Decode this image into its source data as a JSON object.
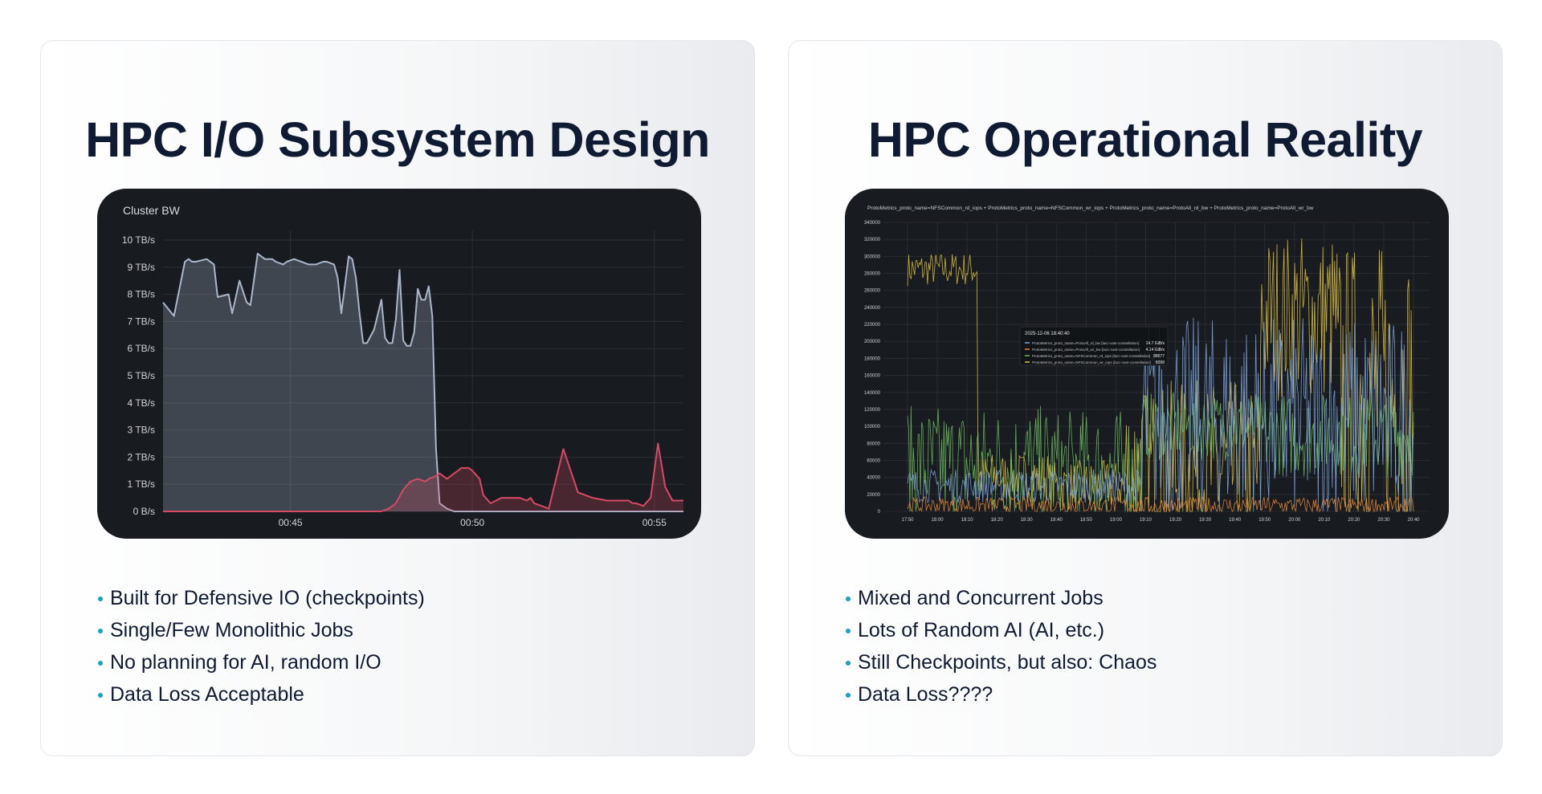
{
  "colors": {
    "title": "#0f1a33",
    "bullet": "#1a9fc4",
    "panel_bg": "#181b1f",
    "grid": "#2c3036",
    "axis_text": "#d0d3d8",
    "series_blue": "#a9b6cc",
    "series_red": "#d64a65",
    "series_lightblue": "#7ea6e0",
    "series_orange": "#e8883a",
    "series_green": "#6ebb5f",
    "series_yellow": "#e0c23f"
  },
  "left": {
    "title": "HPC I/O Subsystem Design",
    "bullets": [
      "Built for Defensive IO (checkpoints)",
      "Single/Few Monolithic Jobs",
      "No planning for AI, random I/O",
      "Data Loss Acceptable"
    ]
  },
  "right": {
    "title": "HPC Operational Reality",
    "bullets": [
      "Mixed and Concurrent Jobs",
      "Lots of Random AI (AI, etc.)",
      "Still Checkpoints, but also: Chaos",
      "Data Loss????"
    ]
  },
  "chart_data": [
    {
      "type": "area",
      "title": "Cluster BW",
      "xlabel": "",
      "ylabel": "",
      "x_ticks": [
        "00:45",
        "00:50",
        "00:55"
      ],
      "x_tick_positions": [
        3.5,
        8.5,
        13.5
      ],
      "xlim": [
        0,
        14.3
      ],
      "ylim": [
        0,
        10
      ],
      "y_ticks": [
        "0 B/s",
        "1 TB/s",
        "2 TB/s",
        "3 TB/s",
        "4 TB/s",
        "5 TB/s",
        "6 TB/s",
        "7 TB/s",
        "8 TB/s",
        "9 TB/s",
        "10 TB/s"
      ],
      "grid": true,
      "series": [
        {
          "color": "#a9b6cc",
          "x": [
            0,
            0.3,
            0.6,
            0.7,
            0.8,
            0.9,
            1.2,
            1.4,
            1.5,
            1.8,
            1.9,
            2.1,
            2.3,
            2.4,
            2.6,
            2.7,
            2.8,
            3.0,
            3.1,
            3.3,
            3.4,
            3.6,
            3.8,
            4.0,
            4.2,
            4.4,
            4.5,
            4.7,
            4.8,
            4.9,
            5.1,
            5.2,
            5.3,
            5.4,
            5.5,
            5.6,
            5.8,
            6.0,
            6.1,
            6.2,
            6.3,
            6.4,
            6.5,
            6.6,
            6.7,
            6.8,
            6.9,
            7.0,
            7.1,
            7.2,
            7.3,
            7.4,
            7.5,
            7.6,
            7.7,
            7.8,
            8.0,
            8.1,
            8.2,
            8.3,
            8.4,
            8.5,
            8.6,
            8.7,
            8.8,
            8.9,
            9.0,
            9.1,
            9.3,
            9.5,
            9.6,
            10.5,
            11.5,
            12.5,
            13.5,
            14.3
          ],
          "values": [
            7.7,
            7.2,
            9.2,
            9.3,
            9.2,
            9.2,
            9.3,
            9.1,
            7.9,
            8.0,
            7.3,
            8.5,
            7.7,
            7.6,
            9.5,
            9.4,
            9.3,
            9.3,
            9.2,
            9.1,
            9.2,
            9.3,
            9.2,
            9.1,
            9.1,
            9.2,
            9.2,
            9.1,
            8.6,
            7.3,
            9.4,
            9.3,
            8.6,
            7.3,
            6.2,
            6.2,
            6.7,
            7.8,
            6.4,
            6.2,
            6.2,
            7.1,
            8.9,
            6.3,
            6.1,
            6.1,
            6.6,
            8.2,
            7.8,
            7.8,
            8.3,
            7.2,
            2.3,
            0.3,
            0.2,
            0.1,
            0.0,
            0.0,
            0.0,
            0.0,
            0.0,
            0.0,
            0.0,
            0.0,
            0.0,
            0.0,
            0.0,
            0.0,
            0.0,
            0.0,
            0.0,
            0.0,
            0.0,
            0.0,
            0.0,
            0.0
          ]
        },
        {
          "color": "#d64a65",
          "x": [
            0,
            1,
            2,
            3,
            4,
            5,
            6,
            6.2,
            6.4,
            6.6,
            6.8,
            7.0,
            7.2,
            7.3,
            7.5,
            7.6,
            7.8,
            7.9,
            8.1,
            8.2,
            8.4,
            8.5,
            8.7,
            8.8,
            9.0,
            9.3,
            9.6,
            9.8,
            10.0,
            10.1,
            10.2,
            10.4,
            10.6,
            11.0,
            11.4,
            11.8,
            12.2,
            12.5,
            12.8,
            12.9,
            13.0,
            13.2,
            13.4,
            13.6,
            13.8,
            14.0,
            14.3
          ],
          "values": [
            0,
            0,
            0,
            0,
            0,
            0,
            0.0,
            0.1,
            0.3,
            0.8,
            1.1,
            1.2,
            1.1,
            1.2,
            1.3,
            1.4,
            1.2,
            1.3,
            1.5,
            1.6,
            1.6,
            1.5,
            1.2,
            0.6,
            0.3,
            0.5,
            0.5,
            0.5,
            0.4,
            0.5,
            0.3,
            0.2,
            0.1,
            2.3,
            0.7,
            0.5,
            0.4,
            0.4,
            0.4,
            0.3,
            0.3,
            0.2,
            0.5,
            2.5,
            0.9,
            0.4,
            0.4
          ]
        }
      ]
    },
    {
      "type": "line",
      "title": "ProtoMetrics_proto_name=NFSCommon_rd_iops + ProtoMetrics_proto_name=NFSCommon_wr_iops + ProtoMetrics_proto_name=ProtoAll_rd_bw + ProtoMetrics_proto_name=ProtoAll_wr_bw",
      "xlabel": "",
      "ylabel": "",
      "x_ticks": [
        "17:50",
        "18:00",
        "18:10",
        "18:20",
        "18:30",
        "18:40",
        "18:50",
        "19:00",
        "19:10",
        "19:20",
        "19:30",
        "19:40",
        "19:50",
        "20:00",
        "20:10",
        "20:20",
        "20:30",
        "20:40"
      ],
      "y_ticks": [
        "0",
        "20000",
        "40000",
        "60000",
        "80000",
        "100000",
        "120000",
        "140000",
        "160000",
        "180000",
        "200000",
        "220000",
        "240000",
        "260000",
        "280000",
        "300000",
        "320000",
        "340000"
      ],
      "ylim": [
        0,
        340000
      ],
      "grid": true,
      "tooltip": {
        "time": "2025-12-06 18:40:40",
        "rows": [
          {
            "label": "ProtoMetrics_proto_name=ProtoAll_rd_bw {lacc-vast-constellation}",
            "value": "14.7 GiB/s",
            "color": "#7ea6e0"
          },
          {
            "label": "ProtoMetrics_proto_name=ProtoAll_wr_bw {lacc-vast-constellation}",
            "value": "4.14 GiB/s",
            "color": "#e8883a"
          },
          {
            "label": "ProtoMetrics_proto_name=NFSCommon_rd_iops {lacc-vast-constellation}",
            "value": "88577",
            "color": "#6ebb5f"
          },
          {
            "label": "ProtoMetrics_proto_name=NFSCommon_wr_iops {lacc-vast-constellation}",
            "value": "8098",
            "color": "#e0c23f"
          }
        ]
      },
      "series": [
        {
          "color": "#e0c23f",
          "segments": [
            [
              0,
              1.2,
              285000,
              20000
            ],
            [
              1.2,
              2.4,
              40000,
              30000
            ],
            [
              2.4,
              3.7,
              30000,
              30000
            ],
            [
              3.7,
              6.0,
              45000,
              110000
            ],
            [
              6.0,
              7.3,
              230000,
              100000
            ],
            [
              7.3,
              8.6,
              140000,
              180000
            ]
          ]
        },
        {
          "color": "#6ebb5f",
          "segments": [
            [
              0,
              2.4,
              55000,
              70000
            ],
            [
              2.4,
              4.0,
              50000,
              70000
            ],
            [
              4.0,
              6.0,
              100000,
              40000
            ],
            [
              6.0,
              8.6,
              90000,
              50000
            ]
          ]
        },
        {
          "color": "#7ea6e0",
          "segments": [
            [
              0,
              4.0,
              30000,
              20000
            ],
            [
              4.0,
              8.6,
              110000,
              120000
            ]
          ]
        },
        {
          "color": "#e8883a",
          "segments": [
            [
              0,
              8.6,
              7000,
              10000
            ]
          ]
        }
      ]
    }
  ]
}
